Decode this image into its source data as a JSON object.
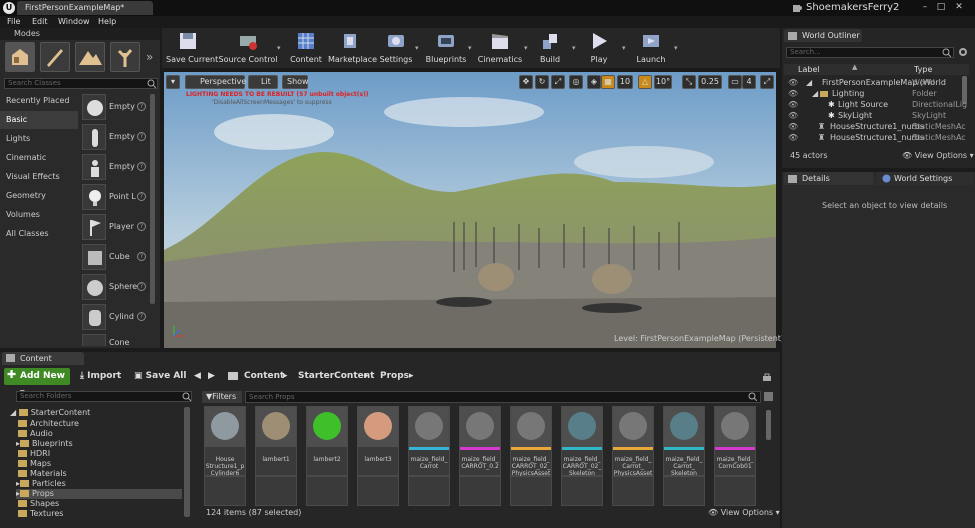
{
  "titlebar": {
    "tab": "FirstPersonExampleMap*",
    "project": "ShoemakersFerry2"
  },
  "menu": [
    "File",
    "Edit",
    "Window",
    "Help"
  ],
  "modes": {
    "title": "Modes",
    "search_placeholder": "Search Classes",
    "categories": [
      "Recently Placed",
      "Basic",
      "Lights",
      "Cinematic",
      "Visual Effects",
      "Geometry",
      "Volumes",
      "All Classes"
    ],
    "selected_category": "Basic",
    "items": [
      "Empty",
      "Empty",
      "Empty",
      "Point L",
      "Player",
      "Cube",
      "Sphere",
      "Cylind",
      "Cone"
    ]
  },
  "toolbar": [
    {
      "label": "Save Current",
      "icon": "save-icon"
    },
    {
      "label": "Source Control",
      "icon": "source-control-icon"
    },
    {
      "label": "Content",
      "icon": "content-icon"
    },
    {
      "label": "Marketplace",
      "icon": "marketplace-icon"
    },
    {
      "label": "Settings",
      "icon": "settings-icon"
    },
    {
      "label": "Blueprints",
      "icon": "blueprints-icon"
    },
    {
      "label": "Cinematics",
      "icon": "cinematics-icon"
    },
    {
      "label": "Build",
      "icon": "build-icon"
    },
    {
      "label": "Play",
      "icon": "play-icon"
    },
    {
      "label": "Launch",
      "icon": "launch-icon"
    }
  ],
  "viewport": {
    "perspective": "Perspective",
    "lit": "Lit",
    "show": "Show",
    "warning": "LIGHTING NEEDS TO BE REBUILT (57 unbuilt object(s))",
    "warning2": "'DisableAllScreenMessages' to suppress",
    "grid_snap": "10",
    "rot_snap": "10°",
    "scale_snap": "0.25",
    "cam_speed": "4",
    "level_label": "Level:",
    "level_name": "FirstPersonExampleMap (Persistent)"
  },
  "outliner": {
    "title": "World Outliner",
    "search_placeholder": "Search...",
    "col_label": "Label",
    "col_type": "Type",
    "rows": [
      {
        "label": "FirstPersonExampleMap (World",
        "type": "World"
      },
      {
        "label": "Lighting",
        "type": "Folder"
      },
      {
        "label": "Light Source",
        "type": "DirectionalLig"
      },
      {
        "label": "SkyLight",
        "type": "SkyLight"
      },
      {
        "label": "HouseStructure1_nurbs",
        "type": "StaticMeshAc"
      },
      {
        "label": "HouseStructure1_nurbs",
        "type": "StaticMeshAc"
      }
    ],
    "actors": "45 actors",
    "view_options": "View Options"
  },
  "details": {
    "tab1": "Details",
    "tab2": "World Settings",
    "message": "Select an object to view details"
  },
  "content_browser": {
    "tab": "Content Browser",
    "add_new": "Add New",
    "import": "Import",
    "save_all": "Save All",
    "breadcrumbs": [
      "Content",
      "StarterContent",
      "Props"
    ],
    "folder_search": "Search Folders",
    "folders": [
      "StarterContent",
      "Architecture",
      "Audio",
      "Blueprints",
      "HDRI",
      "Maps",
      "Materials",
      "Particles",
      "Props",
      "Shapes",
      "Textures"
    ],
    "filters": "Filters",
    "asset_search": "Search Props",
    "assets": [
      {
        "name": "House Structure1_p Cylinder6",
        "color": "#8f9aa0",
        "bar": ""
      },
      {
        "name": "lambert1",
        "color": "#9d8e74",
        "bar": ""
      },
      {
        "name": "lambert2",
        "color": "#3fbf2a",
        "bar": ""
      },
      {
        "name": "lambert3",
        "color": "#d49b7e",
        "bar": ""
      },
      {
        "name": "maize_field_ Carrot",
        "color": "#777",
        "bar": "#36b4d8"
      },
      {
        "name": "maize_field_ CARROT_0.2",
        "color": "#777",
        "bar": "#d83ad0"
      },
      {
        "name": "maize_field_ CARROT_02_ PhysicsAsset",
        "color": "#777",
        "bar": "#e8a83a"
      },
      {
        "name": "maize_field_ CARROT_02_ Skeleton",
        "color": "#587f89",
        "bar": "#2fb7c8"
      },
      {
        "name": "maize_field_ Carrot_ PhysicsAsset",
        "color": "#777",
        "bar": "#e8a83a"
      },
      {
        "name": "maize_field_ Carrot_ Skeleton",
        "color": "#587f89",
        "bar": "#2fb7c8"
      },
      {
        "name": "maize_field_ CornCob01",
        "color": "#777",
        "bar": "#d83ad0"
      }
    ],
    "item_count": "124 items (87 selected)",
    "view_options": "View Options"
  }
}
